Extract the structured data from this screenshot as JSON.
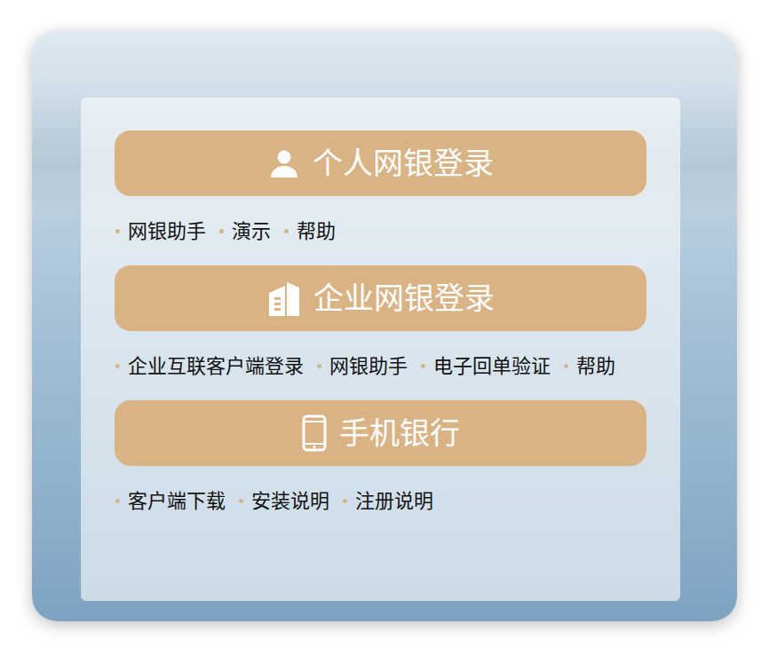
{
  "sections": [
    {
      "kind": "personal",
      "title": "个人网银登录",
      "links": [
        "网银助手",
        "演示",
        "帮助"
      ]
    },
    {
      "kind": "corporate",
      "title": "企业网银登录",
      "links": [
        "企业互联客户端登录",
        "网银助手",
        "电子回单验证",
        "帮助"
      ]
    },
    {
      "kind": "mobile",
      "title": "手机银行",
      "links": [
        "客户端下载",
        "安装说明",
        "注册说明"
      ]
    }
  ]
}
